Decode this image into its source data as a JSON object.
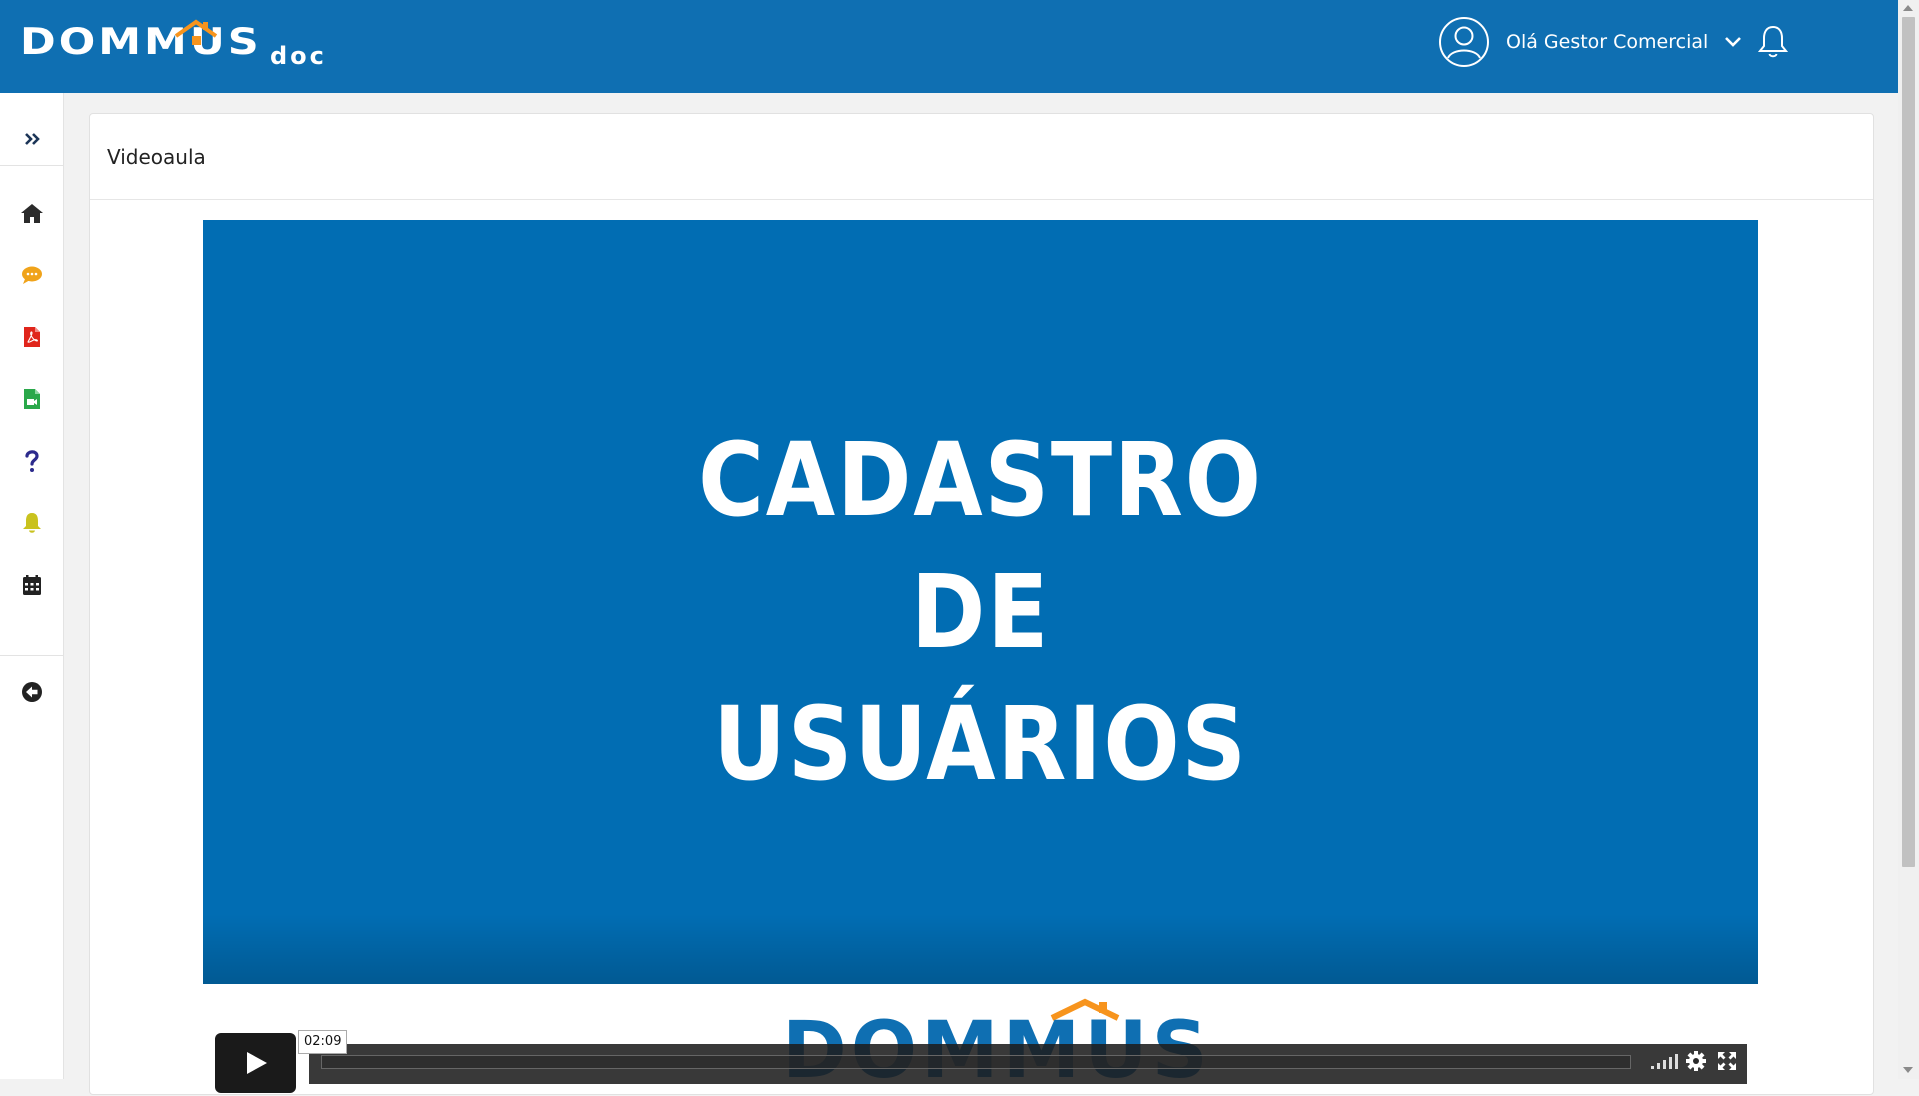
{
  "app": {
    "logo_main": "DOMMUS",
    "logo_sub": "DOC"
  },
  "header": {
    "greeting": "Olá Gestor Comercial",
    "bg_color": "#0f6fb2"
  },
  "sidebar": {
    "items": [
      {
        "icon": "double-chevron-right-icon",
        "color": "#1c3557"
      },
      {
        "icon": "home-icon",
        "color": "#2b2b2b"
      },
      {
        "icon": "chat-icon",
        "color": "#f0a31a"
      },
      {
        "icon": "pdf-file-icon",
        "color": "#e0251b"
      },
      {
        "icon": "video-file-icon",
        "color": "#2aa84a"
      },
      {
        "icon": "question-icon",
        "color": "#2c2a8c"
      },
      {
        "icon": "bell-icon",
        "color": "#c9c21e"
      },
      {
        "icon": "calendar-icon",
        "color": "#222222"
      },
      {
        "icon": "arrow-left-circle-icon",
        "color": "#222222"
      }
    ]
  },
  "card": {
    "title": "Videoaula"
  },
  "video": {
    "title_lines": [
      "CADASTRO",
      "DE",
      "USUÁRIOS"
    ],
    "bg_color": "#016db3",
    "duration": "02:09",
    "watermark": "DOMMUS"
  }
}
